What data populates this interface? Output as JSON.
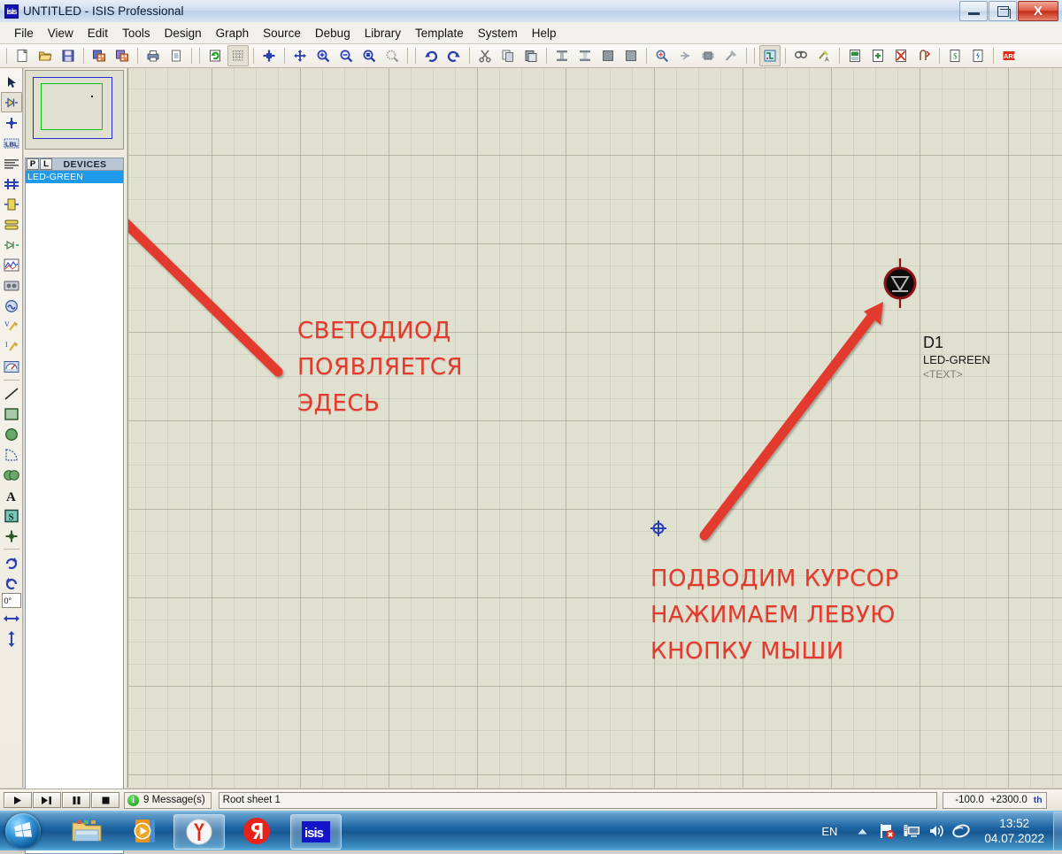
{
  "window": {
    "title": "UNTITLED - ISIS Professional",
    "icon": "isis-icon",
    "buttons": {
      "minimize": "minimize-icon",
      "restore": "restore-icon",
      "close": "X"
    }
  },
  "menubar": {
    "items": [
      "File",
      "View",
      "Edit",
      "Tools",
      "Design",
      "Graph",
      "Source",
      "Debug",
      "Library",
      "Template",
      "System",
      "Help"
    ]
  },
  "toolbar": {
    "groups": [
      [
        "new-file-icon",
        "open-file-icon",
        "save-file-icon"
      ],
      [
        "import-section-icon",
        "export-section-icon"
      ],
      [
        "print-icon",
        "print-area-icon"
      ],
      [
        "refresh-display-icon",
        "toggle-grid-icon"
      ],
      [
        "origin-icon"
      ],
      [
        "pan-icon",
        "zoom-in-icon",
        "zoom-out-icon",
        "zoom-area-icon",
        "zoom-sheet-icon"
      ],
      [
        "undo-icon",
        "redo-icon"
      ],
      [
        "cut-icon",
        "copy-icon",
        "paste-icon"
      ],
      [
        "block-copy-icon",
        "block-move-icon",
        "block-rotate-icon",
        "block-delete-icon"
      ],
      [
        "pick-device-icon",
        "make-device-icon",
        "package-tool-icon",
        "decompose-icon"
      ],
      [
        "wire-autorouter-icon"
      ],
      [
        "search-tag-icon",
        "property-assignment-icon"
      ],
      [
        "design-explorer-icon",
        "new-sheet-icon",
        "remove-sheet-icon",
        "goto-sheet-icon"
      ],
      [
        "bill-of-materials-icon",
        "electrical-rule-check-icon"
      ],
      [
        "netlist-to-ares-icon"
      ]
    ]
  },
  "palette": {
    "tools": [
      {
        "name": "selection-tool",
        "icon": "arrow-icon"
      },
      {
        "name": "component-tool",
        "icon": "component-icon",
        "selected": true
      },
      {
        "name": "junction-dot-tool",
        "icon": "junction-icon"
      },
      {
        "name": "wire-label-tool",
        "icon": "label-icon"
      },
      {
        "name": "text-script-tool",
        "icon": "script-icon"
      },
      {
        "name": "bus-tool",
        "icon": "bus-icon"
      },
      {
        "name": "subcircuit-tool",
        "icon": "subcircuit-icon"
      },
      {
        "name": "terminals-mode",
        "icon": "terminal-icon"
      },
      {
        "name": "device-pins-mode",
        "icon": "pin-icon"
      },
      {
        "name": "graph-mode",
        "icon": "graph-icon"
      },
      {
        "name": "tape-recorder-mode",
        "icon": "tape-icon"
      },
      {
        "name": "generator-mode",
        "icon": "generator-icon"
      },
      {
        "name": "voltage-probe-mode",
        "icon": "voltage-probe-icon"
      },
      {
        "name": "current-probe-mode",
        "icon": "current-probe-icon"
      },
      {
        "name": "virtual-instruments-mode",
        "icon": "instrument-icon"
      },
      {
        "name": "line-tool",
        "icon": "line-icon"
      },
      {
        "name": "box-tool",
        "icon": "box-icon"
      },
      {
        "name": "circle-tool",
        "icon": "circle-icon"
      },
      {
        "name": "arc-tool",
        "icon": "arc-icon"
      },
      {
        "name": "path-tool",
        "icon": "path-icon"
      },
      {
        "name": "text-tool",
        "icon": "text-A-icon"
      },
      {
        "name": "symbol-tool",
        "icon": "symbol-S-icon"
      },
      {
        "name": "marker-tool",
        "icon": "marker-icon"
      }
    ],
    "rotation_value": "0°",
    "rotate_cw": "rotate-cw-icon",
    "rotate_ccw": "rotate-ccw-icon",
    "mirror_x": "mirror-horizontal-icon",
    "mirror_y": "mirror-vertical-icon"
  },
  "left_panel": {
    "overview_title": "overview-preview",
    "devices_header": {
      "pick_button": "P",
      "library_button": "L",
      "label": "DEVICES"
    },
    "devices": [
      {
        "label": "LED-GREEN",
        "selected": true
      }
    ]
  },
  "canvas": {
    "component": {
      "reference": "D1",
      "value": "LED-GREEN",
      "text_property": "<TEXT>",
      "symbol": "led-symbol"
    },
    "cursor": "crosshair-cursor",
    "annotations": [
      {
        "name": "annotation-device-appears-here",
        "text": "СВЕТОДИОД\nПОЯВЛЯЕТСЯ\nЭДЕСЬ",
        "color": "#e23b2e"
      },
      {
        "name": "annotation-click-instruction",
        "text": "ПОДВОДИМ КУРСОР\nНАЖИМАЕМ ЛЕВУЮ\nКНОПКУ МЫШИ",
        "color": "#e23b2e"
      }
    ],
    "arrows": [
      {
        "name": "arrow-to-devices-list"
      },
      {
        "name": "arrow-to-placed-led"
      }
    ]
  },
  "statusbar": {
    "animation_buttons": [
      {
        "name": "play-button",
        "icon": "play-icon"
      },
      {
        "name": "step-button",
        "icon": "step-icon"
      },
      {
        "name": "pause-button",
        "icon": "pause-icon"
      },
      {
        "name": "stop-button",
        "icon": "stop-icon"
      }
    ],
    "messages": "9 Message(s)",
    "messages_icon": "info-icon",
    "sheet": "Root sheet 1",
    "coord_x": "-100.0",
    "coord_y": "+2300.0",
    "coord_unit": "th"
  },
  "taskbar": {
    "start": "windows-start-orb",
    "items": [
      {
        "name": "taskbar-explorer",
        "icon": "folder-icon",
        "active": false
      },
      {
        "name": "taskbar-media-player",
        "icon": "media-player-icon",
        "active": false
      },
      {
        "name": "taskbar-yandex-browser",
        "icon": "yandex-browser-icon",
        "active": true
      },
      {
        "name": "taskbar-yandex",
        "icon": "yandex-logo-icon",
        "active": false
      },
      {
        "name": "taskbar-isis",
        "icon": "isis-app-icon",
        "active": true,
        "label": "isis"
      }
    ],
    "tray": {
      "language": "EN",
      "show_hidden": "chevron-up-icon",
      "icons": [
        "network-flag-error-icon",
        "network-monitor-icon",
        "volume-icon",
        "mouse-icon"
      ],
      "time": "13:52",
      "date": "04.07.2022"
    }
  },
  "colors": {
    "accent_red": "#e23b2e",
    "selection_blue": "#1f9ae8",
    "canvas_bg": "#dfe0d0",
    "title_blue": "#bacfe6"
  }
}
